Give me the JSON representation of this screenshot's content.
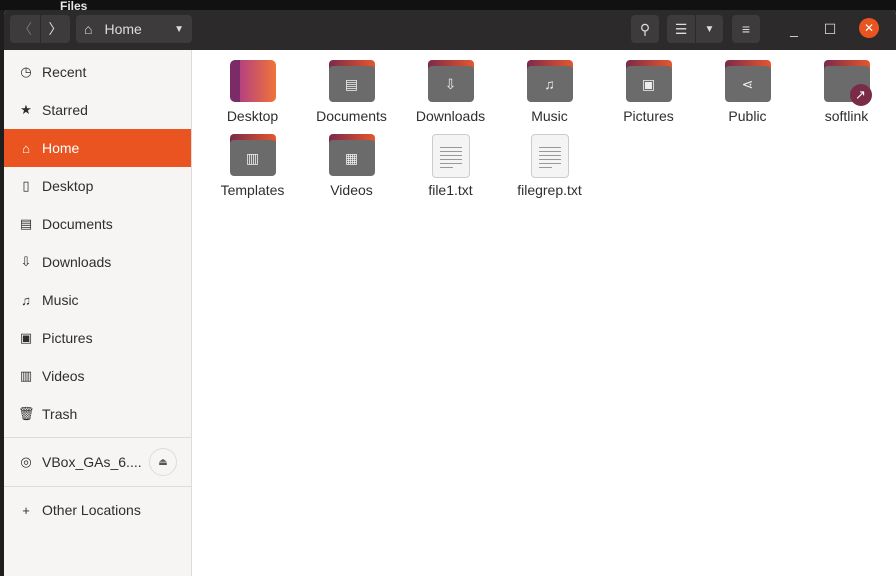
{
  "app_title": "Files",
  "header": {
    "location": "Home"
  },
  "sidebar": {
    "items": [
      {
        "label": "Recent",
        "icon": "clock-icon"
      },
      {
        "label": "Starred",
        "icon": "star-icon"
      },
      {
        "label": "Home",
        "icon": "home-icon",
        "active": true
      },
      {
        "label": "Desktop",
        "icon": "desktop-icon"
      },
      {
        "label": "Documents",
        "icon": "document-icon"
      },
      {
        "label": "Downloads",
        "icon": "download-icon"
      },
      {
        "label": "Music",
        "icon": "music-icon"
      },
      {
        "label": "Pictures",
        "icon": "picture-icon"
      },
      {
        "label": "Videos",
        "icon": "video-icon"
      },
      {
        "label": "Trash",
        "icon": "trash-icon"
      }
    ],
    "device": "VBox_GAs_6....",
    "other": "Other Locations"
  },
  "files": [
    {
      "name": "Desktop"
    },
    {
      "name": "Documents"
    },
    {
      "name": "Downloads"
    },
    {
      "name": "Music"
    },
    {
      "name": "Pictures"
    },
    {
      "name": "Public"
    },
    {
      "name": "softlink"
    },
    {
      "name": "Templates"
    },
    {
      "name": "Videos"
    },
    {
      "name": "file1.txt"
    },
    {
      "name": "filegrep.txt"
    }
  ],
  "colors": {
    "accent": "#e95420",
    "header": "#2c2a2a"
  }
}
